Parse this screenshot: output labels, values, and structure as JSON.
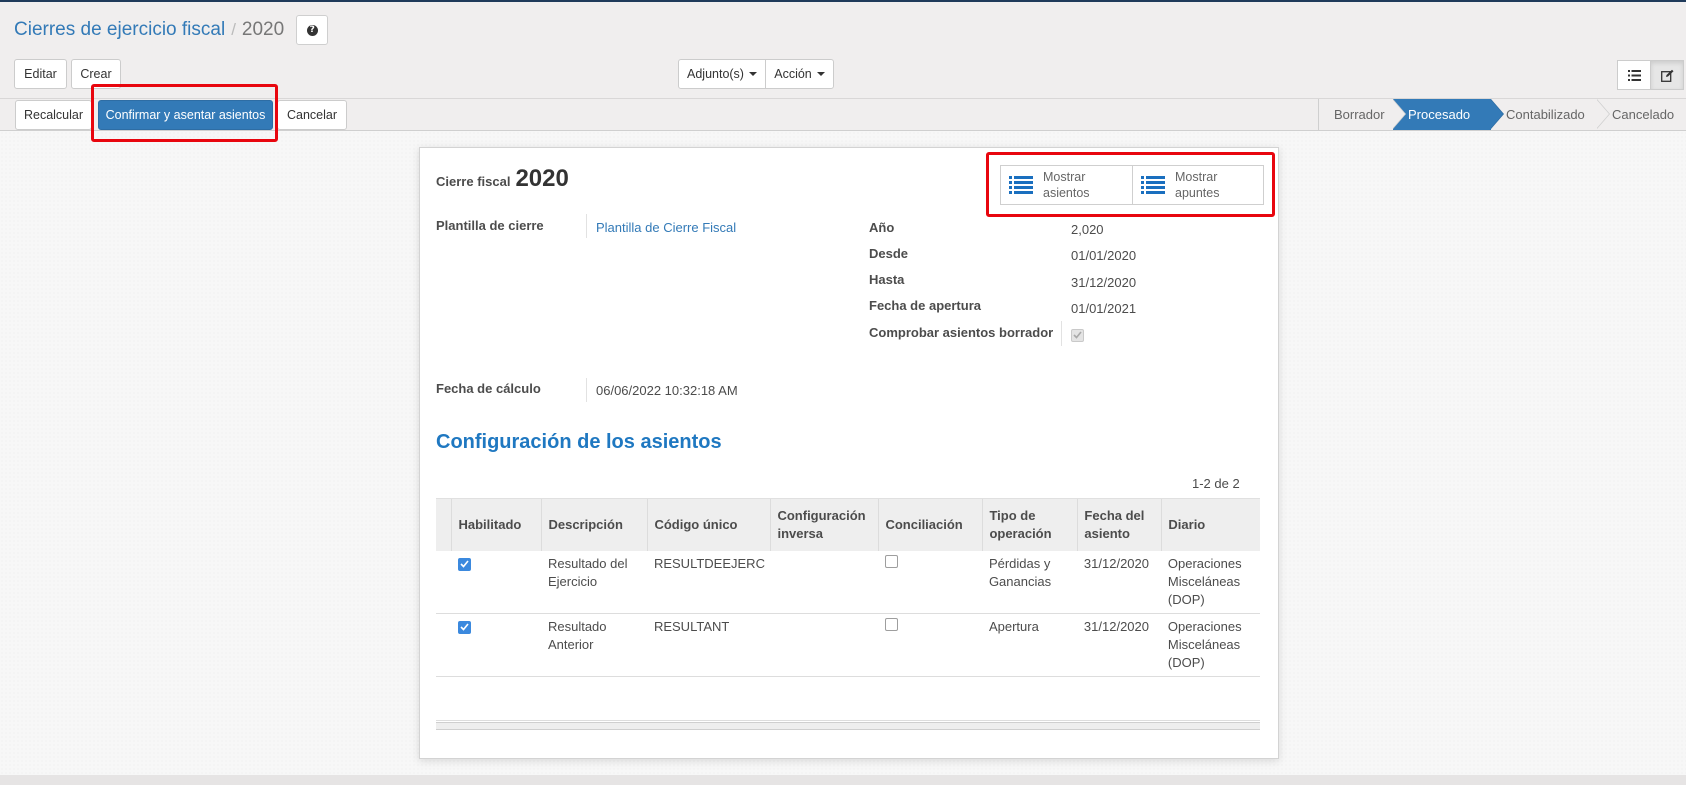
{
  "breadcrumb": {
    "parent": "Cierres de ejercicio fiscal",
    "separator": "/",
    "current": "2020"
  },
  "toolbar": {
    "edit": "Editar",
    "create": "Crear",
    "attachments": "Adjunto(s)",
    "action": "Acción"
  },
  "header_buttons": {
    "recalculate": "Recalcular",
    "confirm": "Confirmar y asentar asientos",
    "cancel": "Cancelar"
  },
  "statusbar": {
    "stages": [
      "Borrador",
      "Procesado",
      "Contabilizado",
      "Cancelado"
    ],
    "active": "Procesado"
  },
  "smart_buttons": {
    "moves_line1": "Mostrar",
    "moves_line2": "asientos",
    "move_lines_line1": "Mostrar",
    "move_lines_line2": "apuntes"
  },
  "form": {
    "title_label": "Cierre fiscal",
    "title_value": "2020",
    "template_label": "Plantilla de cierre",
    "template_value": "Plantilla de Cierre Fiscal",
    "year_label": "Año",
    "year_value": "2,020",
    "from_label": "Desde",
    "from_value": "01/01/2020",
    "to_label": "Hasta",
    "to_value": "31/12/2020",
    "opening_label": "Fecha de apertura",
    "opening_value": "01/01/2021",
    "check_draft_label": "Comprobar asientos borrador",
    "check_draft_value": true,
    "calc_label": "Fecha de cálculo",
    "calc_value": "06/06/2022 10:32:18 AM"
  },
  "section": {
    "title": "Configuración de los asientos",
    "pager": "1-2 de 2"
  },
  "table": {
    "headers": {
      "enabled": "Habilitado",
      "description": "Descripción",
      "code": "Código único",
      "inverse_l1": "Configuración",
      "inverse_l2": "inversa",
      "reconcile": "Conciliación",
      "optype_l1": "Tipo de",
      "optype_l2": "operación",
      "date_l1": "Fecha del",
      "date_l2": "asiento",
      "journal": "Diario"
    },
    "rows": [
      {
        "enabled": true,
        "desc_l1": "Resultado del",
        "desc_l2": "Ejercicio",
        "code": "RESULTDEEJERC",
        "inverse": "",
        "reconcile": false,
        "optype_l1": "Pérdidas y",
        "optype_l2": "Ganancias",
        "date": "31/12/2020",
        "journal_l1": "Operaciones",
        "journal_l2": "Misceláneas",
        "journal_l3": "(DOP)"
      },
      {
        "enabled": true,
        "desc_l1": "Resultado",
        "desc_l2": "Anterior",
        "code": "RESULTANT",
        "inverse": "",
        "reconcile": false,
        "optype_l1": "Apertura",
        "optype_l2": "",
        "date": "31/12/2020",
        "journal_l1": "Operaciones",
        "journal_l2": "Misceláneas",
        "journal_l3": "(DOP)"
      }
    ]
  },
  "colors": {
    "primary": "#337ab7",
    "highlight": "#e8060e",
    "panel": "#f0eeee",
    "checkbox": "#3b89de",
    "section_title": "#1f78c1"
  }
}
